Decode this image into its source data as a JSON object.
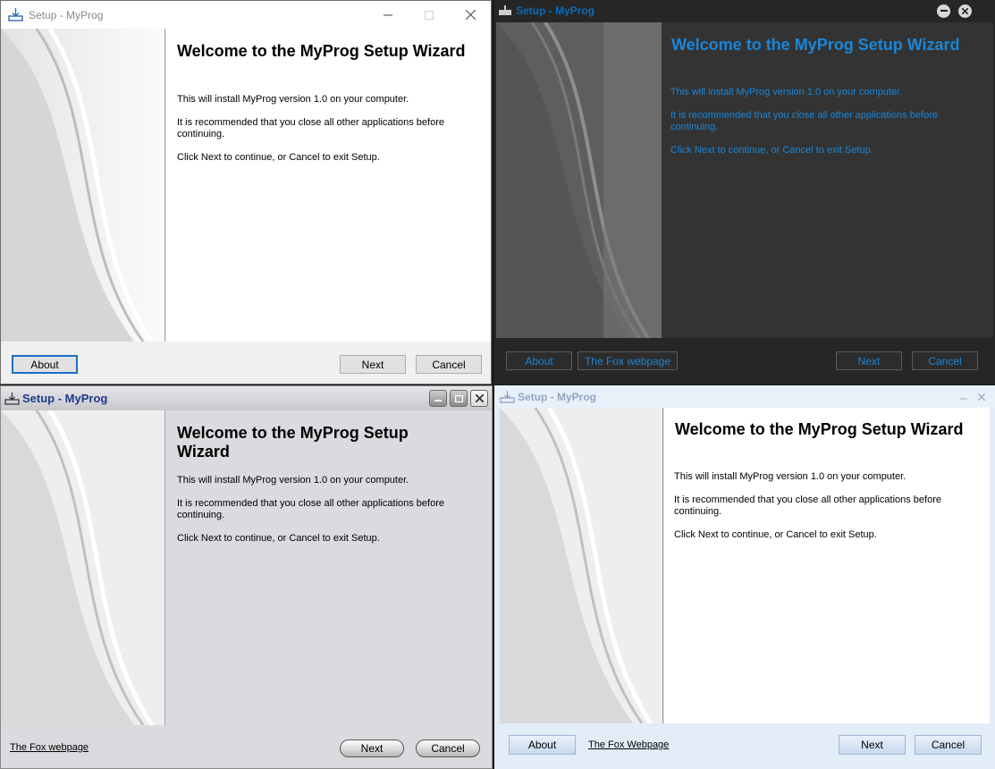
{
  "windows": [
    {
      "title": "Setup - MyProg",
      "heading": "Welcome to the MyProg Setup Wizard",
      "line1": "This will install MyProg version 1.0 on your computer.",
      "line2": "It is recommended that you close all other applications before continuing.",
      "line3": "Click Next to continue, or Cancel to exit Setup.",
      "about_label": "About",
      "next_label": "Next",
      "cancel_label": "Cancel"
    },
    {
      "title": "Setup - MyProg",
      "heading": "Welcome to the MyProg Setup Wizard",
      "line1": "This will install MyProg version 1.0 on your computer.",
      "line2": "It is recommended that you close all other applications before continuing.",
      "line3": "Click Next to continue, or Cancel to exit Setup.",
      "about_label": "About",
      "link_label": "The Fox webpage",
      "next_label": "Next",
      "cancel_label": "Cancel"
    },
    {
      "title": "Setup - MyProg",
      "heading": "Welcome to the MyProg Setup Wizard",
      "line1": "This will install MyProg version 1.0 on your computer.",
      "line2": "It is recommended that you close all other applications before continuing.",
      "line3": "Click Next to continue, or Cancel to exit Setup.",
      "link_label": "The Fox webpage",
      "next_label": "Next",
      "cancel_label": "Cancel"
    },
    {
      "title": "Setup - MyProg",
      "heading": "Welcome to the MyProg Setup Wizard",
      "line1": "This will install MyProg version 1.0 on your computer.",
      "line2": "It is recommended that you close all other applications before continuing.",
      "line3": "Click Next to continue, or Cancel to exit Setup.",
      "about_label": "About",
      "link_label": "The Fox Webpage",
      "next_label": "Next",
      "cancel_label": "Cancel"
    }
  ],
  "colors": {
    "dark_accent": "#1a86d8",
    "classic_title": "#1c3a8c",
    "light_title": "#93a6c2"
  },
  "icons": [
    "setup-icon",
    "minimize-icon",
    "maximize-icon",
    "close-icon"
  ]
}
